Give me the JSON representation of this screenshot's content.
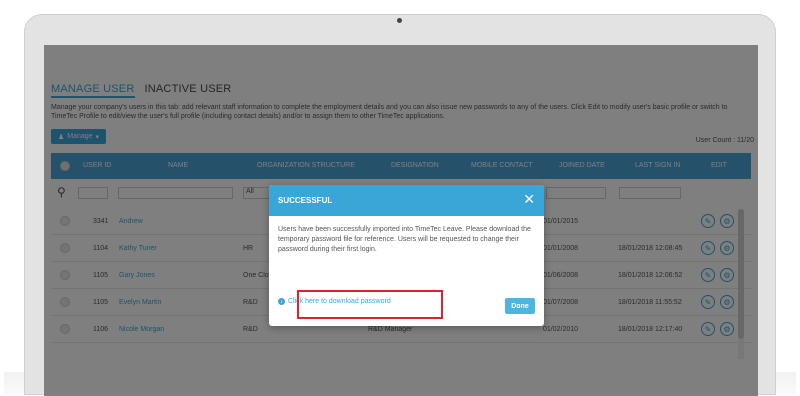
{
  "tabs": [
    {
      "label": "MANAGE USER"
    },
    {
      "label": "INACTIVE USER"
    }
  ],
  "description": "Manage your company's users in this tab: add relevant staff information to complete the employment details and you can also issue new passwords to any of the users. Click Edit to modify user's basic profile or switch to TimeTec Profile to edit/view the user's full profile (including contact details) and/or to assign them to other TimeTec applications.",
  "toolbar": {
    "manage_label": "Manage",
    "user_count": "User Count : 11/20"
  },
  "columns": [
    "USER ID",
    "NAME",
    "ORGANIZATION STRUCTURE",
    "DESIGNATION",
    "MOBILE CONTACT",
    "JOINED DATE",
    "LAST SIGN IN",
    "EDIT"
  ],
  "filters": {
    "org_value": "All"
  },
  "rows": [
    {
      "id": "3341",
      "name": "Andrew",
      "org": "",
      "designation": "",
      "joined": "01/01/2015",
      "last_sign_in": ""
    },
    {
      "id": "1104",
      "name": "Kathy Tuner",
      "org": "HR",
      "designation": "",
      "joined": "01/01/2008",
      "last_sign_in": "18/01/2018 12:08:45"
    },
    {
      "id": "1105",
      "name": "Gary Jones",
      "org": "One Clo",
      "designation": "",
      "joined": "01/06/2008",
      "last_sign_in": "18/01/2018 12:06:52"
    },
    {
      "id": "1105",
      "name": "Evelyn Martin",
      "org": "R&D",
      "designation": "",
      "joined": "01/07/2008",
      "last_sign_in": "18/01/2018 11:55:52"
    },
    {
      "id": "1106",
      "name": "Nicole Morgan",
      "org": "R&D",
      "designation": "R&D Manager",
      "joined": "01/02/2010",
      "last_sign_in": "18/01/2018 12:17:40"
    }
  ],
  "modal": {
    "title": "SUCCESSFUL",
    "message": "Users have been successfully imported into TimeTec Leave. Please download the temporary password file for reference. Users will be requested to change their password during their first login.",
    "download_label": "Click here to download password",
    "done_label": "Done"
  },
  "colors": {
    "accent": "#3aa6d8",
    "highlight": "#d9232d"
  }
}
